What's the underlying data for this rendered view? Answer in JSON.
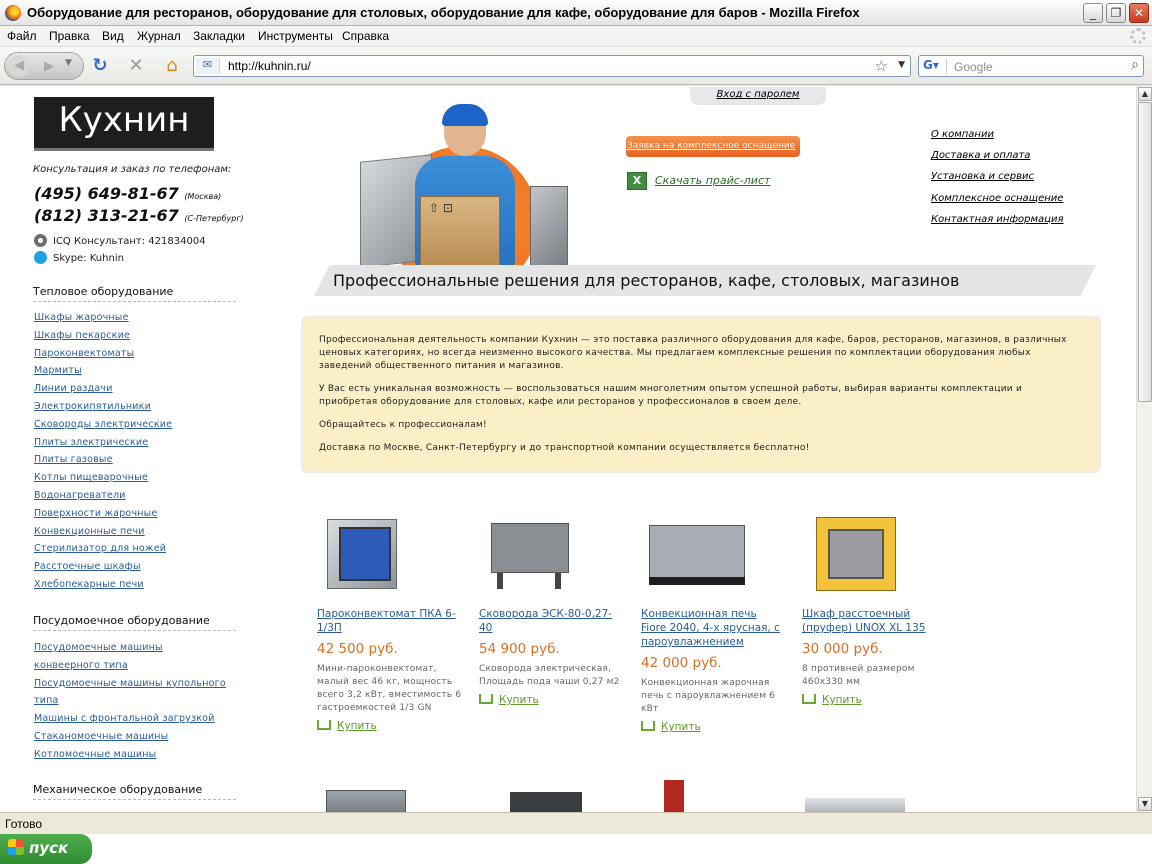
{
  "window": {
    "title": "Оборудование для ресторанов, оборудование для столовых, оборудование для кафе, оборудование для баров - Mozilla Firefox",
    "btn_min": "_",
    "btn_max": "❐",
    "btn_close": "✕"
  },
  "menu": [
    "Файл",
    "Правка",
    "Вид",
    "Журнал",
    "Закладки",
    "Инструменты",
    "Справка"
  ],
  "nav": {
    "url": "http://kuhnin.ru/",
    "search_placeholder": "Google"
  },
  "status": "Готово",
  "taskbar": {
    "start_label": "пуск"
  },
  "page": {
    "logo": "Кухнин",
    "consult_text": "Консультация и заказ по телефонам:",
    "phone1": "(495) 649-81-67",
    "phone1_city": "(Москва)",
    "phone2": "(812) 313-21-67",
    "phone2_city": "(С-Петербург)",
    "icq": "ICQ Консультант: 421834004",
    "skype": "Skype: Kuhnin",
    "login": "Вход с паролем",
    "order_button": "Заявка на комплексное оснащение",
    "price_list": "Скачать прайс-лист",
    "top_links": [
      "О компании",
      "Доставка и оплата",
      "Установка и сервис",
      "Комплексное оснащение",
      "Контактная информация"
    ],
    "banner": "Профессиональные решения для ресторанов, кафе, столовых, магазинов",
    "about": [
      "Профессиональная деятельность компании Кухнин — это поставка различного оборудования для кафе, баров, ресторанов, магазинов, в различных ценовых категориях, но всегда неизменно высокого качества. Мы предлагаем комплексные решения по комплектации оборудования любых заведений общественного питания и магазинов.",
      "У Вас есть уникальная возможность — воспользоваться нашим многолетним опытом успешной работы, выбирая варианты комплектации и приобретая оборудование для столовых, кафе или ресторанов у профессионалов в своем деле.",
      "Обращайтесь к профессионалам!",
      "Доставка по Москве, Санкт-Петербургу и до транспортной компании осуществляется бесплатно!"
    ],
    "sections": [
      {
        "title": "Тепловое оборудование",
        "items": [
          "Шкафы жарочные",
          "Шкафы пекарские",
          "Пароконвектоматы",
          "Мармиты",
          "Линии раздачи",
          "Электрокипятильники",
          "Сковороды электрические",
          "Плиты электрические",
          "Плиты газовые",
          "Котлы пищеварочные",
          "Водонагреватели",
          "Поверхности жарочные",
          "Конвекционные печи",
          "Стерилизатор для ножей",
          "Расстоечные шкафы",
          "Хлебопекарные печи"
        ]
      },
      {
        "title": "Посудомоечное оборудование",
        "items": [
          "Посудомоечные машины конвеерного типа",
          "Посудомоечные машины купольного типа",
          "Машины с фронтальной загрузкой",
          "Стаканомоечные машины",
          "Котломоечные машины"
        ]
      },
      {
        "title": "Механическое оборудование",
        "items": []
      }
    ],
    "products": [
      {
        "name": "Пароконвектомат ПКА 6-1/3П",
        "price": "42 500 руб.",
        "desc": "Мини-пароконвектомат, малый вес 46 кг, мощность всего 3,2 кВт, вместимость 6 гастроемкостей 1/3 GN",
        "buy": "Купить",
        "img_color": "#2c5bb8"
      },
      {
        "name": "Сковорода ЭСК-80-0,27-40",
        "price": "54 900 руб.",
        "desc": "Сковорода электрическая, Площадь пода чаши 0,27 м2",
        "buy": "Купить",
        "img_color": "#8a8d91"
      },
      {
        "name": "Конвекционная печь Fiore 2040, 4-х ярусная, с пароувлажнением",
        "price": "42 000 руб.",
        "desc": "Конвекционная жарочная печь с пароувлажнением 6 кВт",
        "buy": "Купить",
        "img_color": "#a9adb3"
      },
      {
        "name": "Шкаф расстоечный (пруфер) UNOX XL 135",
        "price": "30 000 руб.",
        "desc": "8 противней размером 460x330 мм",
        "buy": "Купить",
        "img_color": "#f2c23a"
      }
    ]
  }
}
